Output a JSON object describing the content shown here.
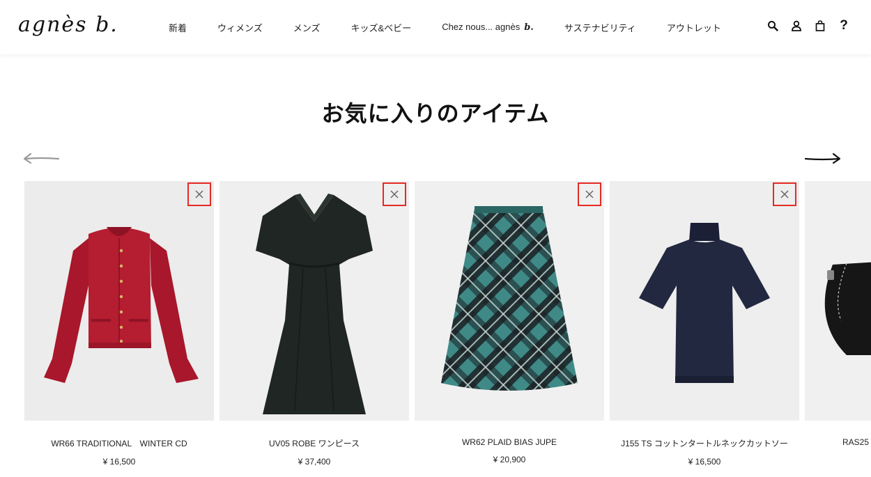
{
  "header": {
    "logo": "agnès b.",
    "nav": [
      {
        "label": "新着"
      },
      {
        "label": "ウィメンズ"
      },
      {
        "label": "メンズ"
      },
      {
        "label": "キッズ&ベビー"
      },
      {
        "label": "Chez nous... agnès",
        "mark": "b."
      },
      {
        "label": "サステナビリティ"
      },
      {
        "label": "アウトレット"
      }
    ],
    "icons": [
      "search-icon",
      "account-icon",
      "bag-icon",
      "help-icon"
    ],
    "help_glyph": "?"
  },
  "page": {
    "title": "お気に入りのアイテム"
  },
  "colors": {
    "accent_remove_border": "#e52a23",
    "card_bg": "#ececec",
    "arrow_inactive": "#9a9a9a",
    "arrow_active": "#111111"
  },
  "products": [
    {
      "name": "WR66 TRADITIONAL　WINTER CD",
      "price": "¥ 16,500",
      "image": "red-cardigan"
    },
    {
      "name": "UV05 ROBE ワンピース",
      "price": "¥ 37,400",
      "image": "black-dress"
    },
    {
      "name": "WR62 PLAID BIAS JUPE",
      "price": "¥ 20,900",
      "image": "plaid-skirt"
    },
    {
      "name": "J155 TS コットンタートルネックカットソー",
      "price": "¥ 16,500",
      "image": "navy-turtleneck"
    },
    {
      "name": "RAS25",
      "price": "",
      "image": "black-bag"
    }
  ]
}
